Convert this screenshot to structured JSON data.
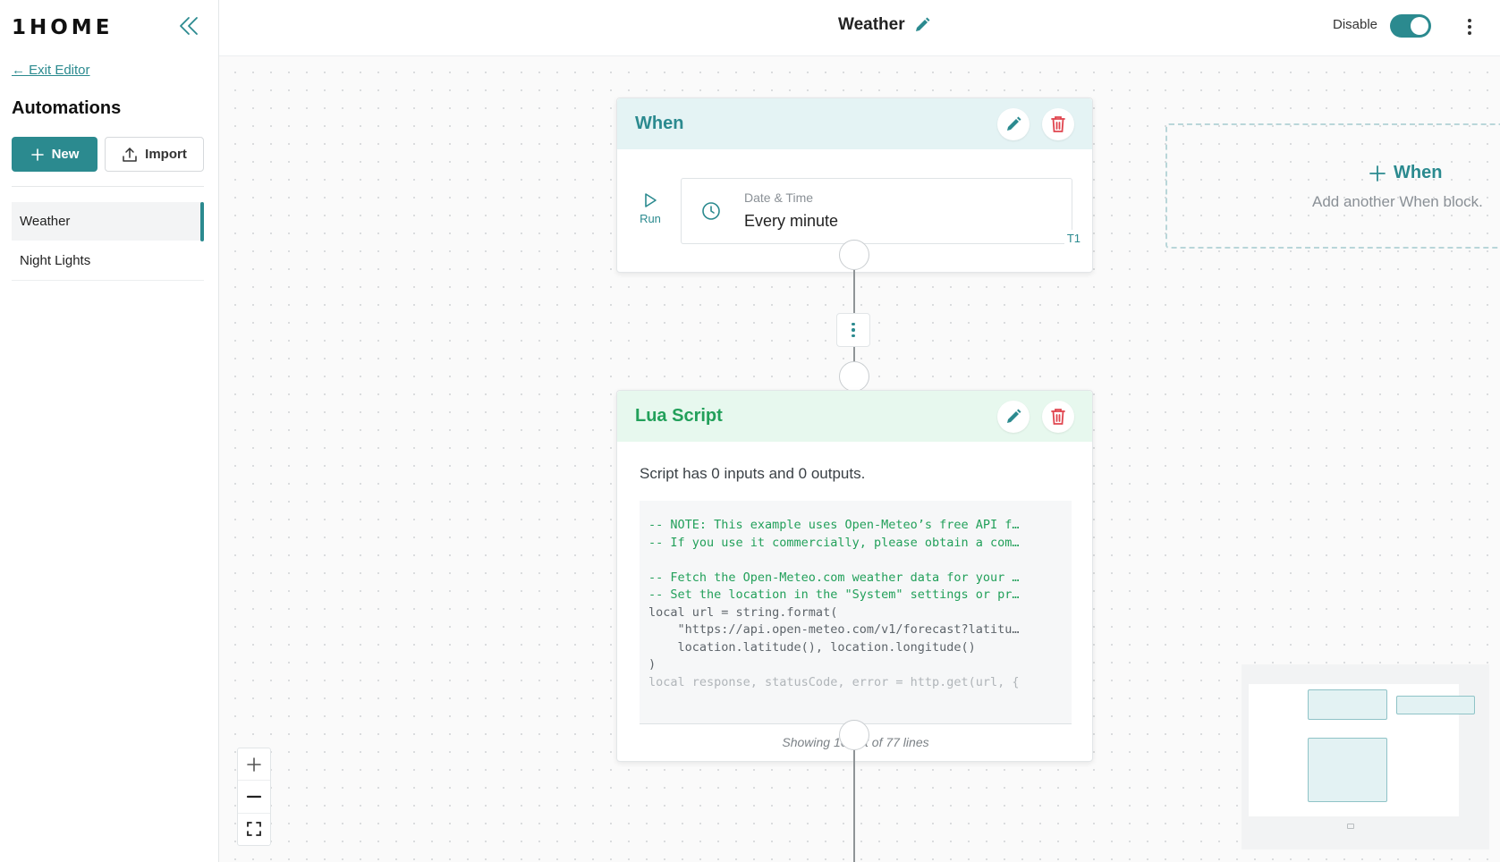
{
  "brand": {
    "logo_text": "1HOME"
  },
  "sidebar": {
    "exit_label": "← Exit Editor",
    "heading": "Automations",
    "new_label": "New",
    "import_label": "Import",
    "items": [
      {
        "label": "Weather",
        "active": true
      },
      {
        "label": "Night Lights",
        "active": false
      }
    ]
  },
  "header": {
    "title": "Weather",
    "toggle_label": "Disable",
    "toggle_on": true
  },
  "canvas": {
    "when_block": {
      "title": "When",
      "run_label": "Run",
      "trigger_type": "Date & Time",
      "trigger_value": "Every minute",
      "trigger_tag": "T1"
    },
    "lua_block": {
      "title": "Lua Script",
      "summary": "Script has 0 inputs and 0 outputs.",
      "code_lines": [
        "-- NOTE: This example uses Open-Meteo’s free API f…",
        "-- If you use it commercially, please obtain a com…",
        "",
        "-- Fetch the Open-Meteo.com weather data for your …",
        "-- Set the location in the \"System\" settings or pr…",
        "local url = string.format(",
        "    \"https://api.open-meteo.com/v1/forecast?latitu…",
        "    location.latitude(), location.longitude()",
        ")",
        "local response, statusCode, error = http.get(url, {"
      ],
      "footer": "Showing 10 out of 77 lines"
    },
    "add_when": {
      "title": "When",
      "subtitle": "Add another When block."
    }
  },
  "colors": {
    "accent": "#2b8a8f",
    "lua_green": "#22a05a",
    "delete_red": "#e0454f"
  },
  "icons": {
    "collapse": "double-chevron-left-icon",
    "edit": "pencil-icon",
    "delete": "trash-icon",
    "run": "play-icon",
    "clock": "clock-icon",
    "new": "plus-icon",
    "import": "upload-icon"
  }
}
